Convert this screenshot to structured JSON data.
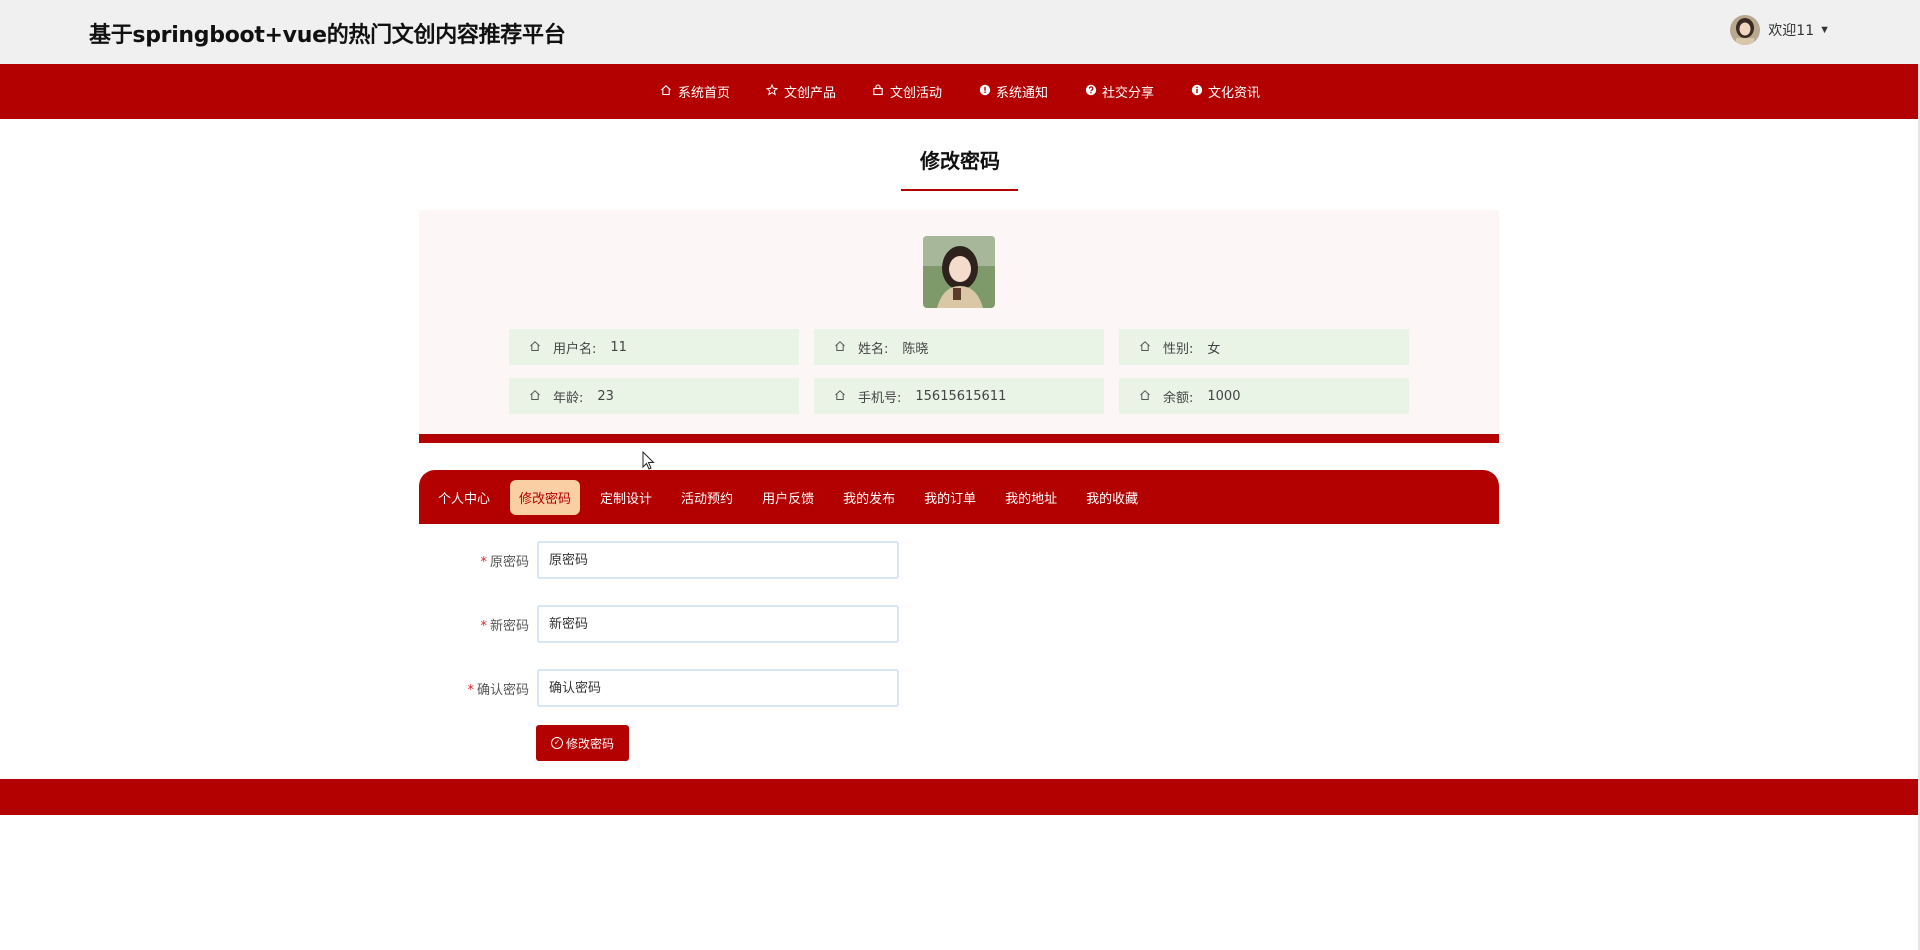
{
  "header": {
    "site_title": "基于springboot+vue的热门文创内容推荐平台",
    "welcome_text": "欢迎11",
    "caret_icon": "caret-down-icon"
  },
  "nav": [
    {
      "label": "系统首页",
      "icon": "home-icon"
    },
    {
      "label": "文创产品",
      "icon": "star-icon"
    },
    {
      "label": "文创活动",
      "icon": "bag-icon"
    },
    {
      "label": "系统通知",
      "icon": "alert-icon"
    },
    {
      "label": "社交分享",
      "icon": "question-icon"
    },
    {
      "label": "文化资讯",
      "icon": "info-icon"
    }
  ],
  "page": {
    "heading": "修改密码",
    "accent_color": "#b30000"
  },
  "profile": {
    "fields": [
      {
        "label": "用户名:",
        "value": "11"
      },
      {
        "label": "姓名:",
        "value": "陈晓"
      },
      {
        "label": "性别:",
        "value": "女"
      },
      {
        "label": "年龄:",
        "value": "23"
      },
      {
        "label": "手机号:",
        "value": "15615615611"
      },
      {
        "label": "余额:",
        "value": "1000"
      }
    ]
  },
  "tabs": [
    {
      "label": "个人中心",
      "active": false
    },
    {
      "label": "修改密码",
      "active": true
    },
    {
      "label": "定制设计",
      "active": false
    },
    {
      "label": "活动预约",
      "active": false
    },
    {
      "label": "用户反馈",
      "active": false
    },
    {
      "label": "我的发布",
      "active": false
    },
    {
      "label": "我的订单",
      "active": false
    },
    {
      "label": "我的地址",
      "active": false
    },
    {
      "label": "我的收藏",
      "active": false
    }
  ],
  "form": {
    "old_password": {
      "label": "原密码",
      "placeholder": "原密码",
      "required": true
    },
    "new_password": {
      "label": "新密码",
      "placeholder": "新密码",
      "required": true
    },
    "confirm_password": {
      "label": "确认密码",
      "placeholder": "确认密码",
      "required": true
    },
    "submit_label": "修改密码",
    "submit_icon": "check-circle-icon"
  }
}
